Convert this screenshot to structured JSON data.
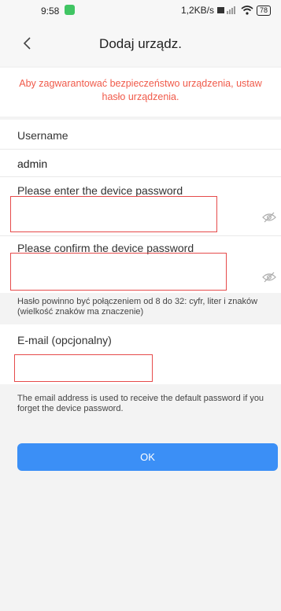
{
  "status": {
    "time": "9:58",
    "badge": "",
    "net_speed": "1,2KB/s",
    "battery": "78"
  },
  "header": {
    "title": "Dodaj urządz."
  },
  "warning": "Aby zagwarantować bezpieczeństwo urządzenia, ustaw hasło urządzenia.",
  "form": {
    "username_label": "Username",
    "username_value": "admin",
    "password_label": "Please enter the device password",
    "confirm_label": "Please confirm the device password",
    "password_hint": "Hasło powinno być połączeniem od 8 do 32: cyfr, liter i znaków (wielkość znaków ma znaczenie)",
    "email_label": "E-mail (opcjonalny)",
    "email_hint": "The email address is used to receive the default password if you forget the device password."
  },
  "buttons": {
    "ok": "OK"
  },
  "icons": {
    "back": "chevron-left-icon",
    "eye": "eye-off-icon"
  },
  "colors": {
    "primary": "#3b8ff6",
    "warning": "#f05a4a",
    "highlight_border": "#e64b4b"
  }
}
